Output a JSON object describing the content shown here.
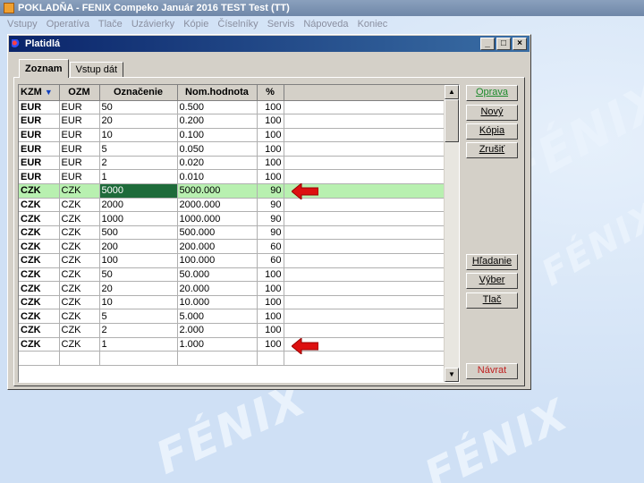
{
  "app": {
    "title": "POKLADŇA - FENIX Compeko  Január 2016  TEST Test  (TT)",
    "menu": [
      "Vstupy",
      "Operatíva",
      "Tlače",
      "Uzávierky",
      "Kópie",
      "Číselníky",
      "Servis",
      "Nápoveda",
      "Koniec"
    ]
  },
  "window": {
    "title": "Platidlá",
    "controls": {
      "minimize": "_",
      "maximize": "□",
      "close": "×"
    }
  },
  "tabs": [
    {
      "label": "Zoznam",
      "active": true
    },
    {
      "label": "Vstup dát",
      "active": false
    }
  ],
  "grid": {
    "columns": [
      "KZM",
      "OZM",
      "Označenie",
      "Nom.hodnota",
      "%"
    ],
    "selected_row": 6,
    "rows": [
      [
        "EUR",
        "EUR",
        "50",
        "0.500",
        "100"
      ],
      [
        "EUR",
        "EUR",
        "20",
        "0.200",
        "100"
      ],
      [
        "EUR",
        "EUR",
        "10",
        "0.100",
        "100"
      ],
      [
        "EUR",
        "EUR",
        "5",
        "0.050",
        "100"
      ],
      [
        "EUR",
        "EUR",
        "2",
        "0.020",
        "100"
      ],
      [
        "EUR",
        "EUR",
        "1",
        "0.010",
        "100"
      ],
      [
        "CZK",
        "CZK",
        "5000",
        "5000.000",
        "90"
      ],
      [
        "CZK",
        "CZK",
        "2000",
        "2000.000",
        "90"
      ],
      [
        "CZK",
        "CZK",
        "1000",
        "1000.000",
        "90"
      ],
      [
        "CZK",
        "CZK",
        "500",
        "500.000",
        "90"
      ],
      [
        "CZK",
        "CZK",
        "200",
        "200.000",
        "60"
      ],
      [
        "CZK",
        "CZK",
        "100",
        "100.000",
        "60"
      ],
      [
        "CZK",
        "CZK",
        "50",
        "50.000",
        "100"
      ],
      [
        "CZK",
        "CZK",
        "20",
        "20.000",
        "100"
      ],
      [
        "CZK",
        "CZK",
        "10",
        "10.000",
        "100"
      ],
      [
        "CZK",
        "CZK",
        "5",
        "5.000",
        "100"
      ],
      [
        "CZK",
        "CZK",
        "2",
        "2.000",
        "100"
      ],
      [
        "CZK",
        "CZK",
        "1",
        "1.000",
        "100"
      ],
      [
        "",
        "",
        "",
        "",
        ""
      ]
    ]
  },
  "buttons": {
    "oprava": "Oprava",
    "novy": "Nový",
    "kopia": "Kópia",
    "zrusit": "Zrušiť",
    "hladanie": "Hľadanie",
    "vyber": "Výber",
    "tlac": "Tlač",
    "navrat": "Návrat"
  },
  "watermark": "FÉNIX",
  "colors": {
    "selected_row": "#b8f0b0",
    "selected_cell": "#1e6b3a",
    "arrow": "#dd1010",
    "title_bar": "#0a246a"
  }
}
